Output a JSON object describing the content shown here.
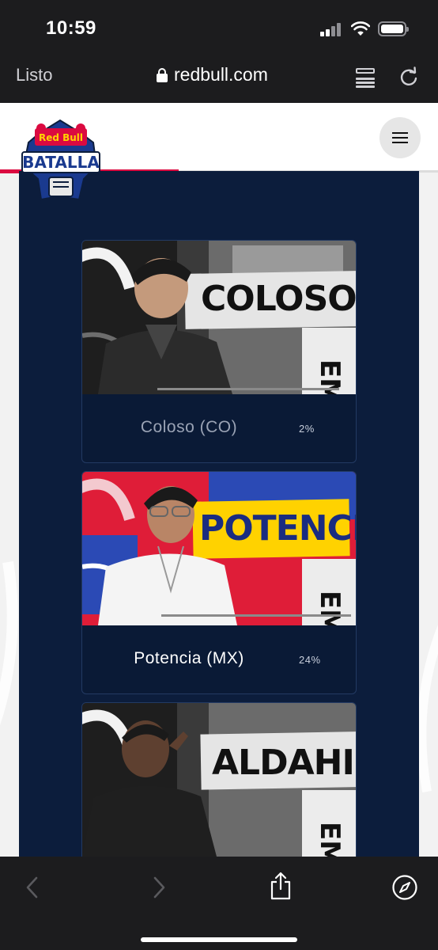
{
  "status_bar": {
    "time": "10:59"
  },
  "browser": {
    "done_label": "Listo",
    "url": "redbull.com"
  },
  "site": {
    "logo_text_top": "Red Bull",
    "logo_text_main": "BATALLA"
  },
  "cards": [
    {
      "poster_name": "COLOSO",
      "name": "Coloso (CO)",
      "percent": "2%",
      "percent_value": 2,
      "name_color": "#9aa3b5"
    },
    {
      "poster_name": "POTENCIA",
      "name": "Potencia (MX)",
      "percent": "24%",
      "percent_value": 24,
      "name_color": "#ffffff"
    },
    {
      "poster_name": "ALDAHIR",
      "name": "",
      "percent": ""
    }
  ],
  "icons": {
    "back": "chevron-left-icon",
    "forward": "chevron-right-icon",
    "share": "share-icon",
    "compass": "compass-icon",
    "reader": "reader-mode-icon",
    "reload": "reload-icon"
  },
  "colors": {
    "brand_red": "#db0a40",
    "panel_navy": "#0c1d3c"
  }
}
